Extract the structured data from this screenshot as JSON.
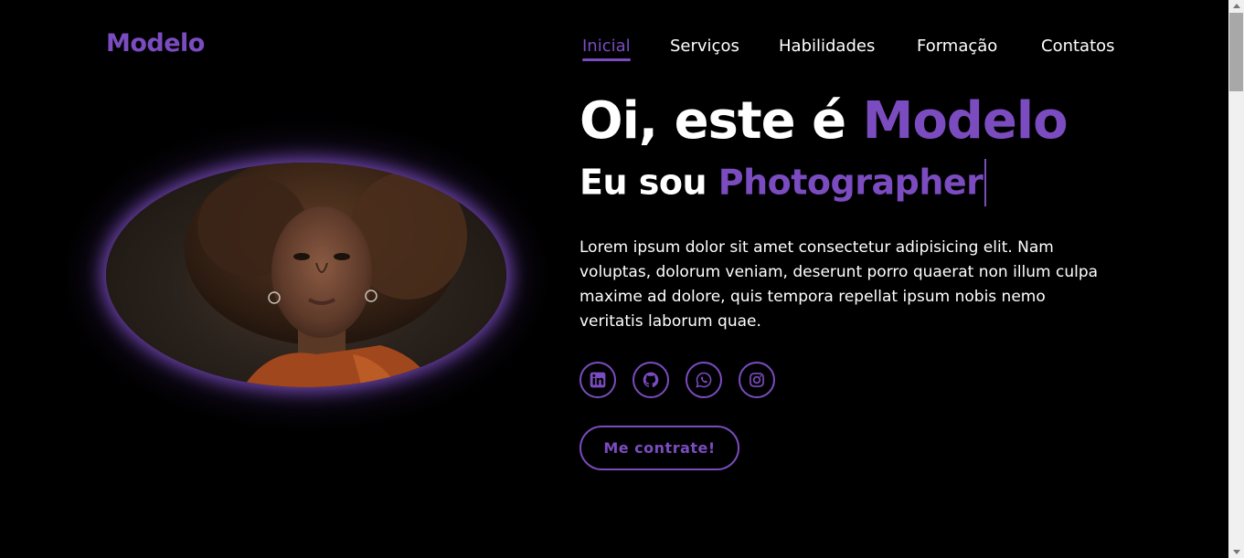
{
  "brand": {
    "logo": "Modelo"
  },
  "nav": {
    "items": [
      {
        "label": "Inicial",
        "active": true
      },
      {
        "label": "Serviços",
        "active": false
      },
      {
        "label": "Habilidades",
        "active": false
      },
      {
        "label": "Formação",
        "active": false
      },
      {
        "label": "Contatos",
        "active": false
      }
    ]
  },
  "hero": {
    "greeting_prefix": "Oi, este é ",
    "greeting_name": "Modelo",
    "role_prefix": "Eu sou ",
    "role_value": "Photographer",
    "description": "Lorem ipsum dolor sit amet consectetur adipisicing elit. Nam voluptas, dolorum veniam, deserunt porro quaerat non illum culpa maxime ad dolore, quis tempora repellat ipsum nobis nemo veritatis laborum quae.",
    "cta_label": "Me contrate!"
  },
  "socials": [
    {
      "icon": "linkedin-icon"
    },
    {
      "icon": "github-icon"
    },
    {
      "icon": "whatsapp-icon"
    },
    {
      "icon": "instagram-icon"
    }
  ],
  "colors": {
    "accent": "#7b4cc0",
    "background": "#000000",
    "text": "#ffffff"
  }
}
